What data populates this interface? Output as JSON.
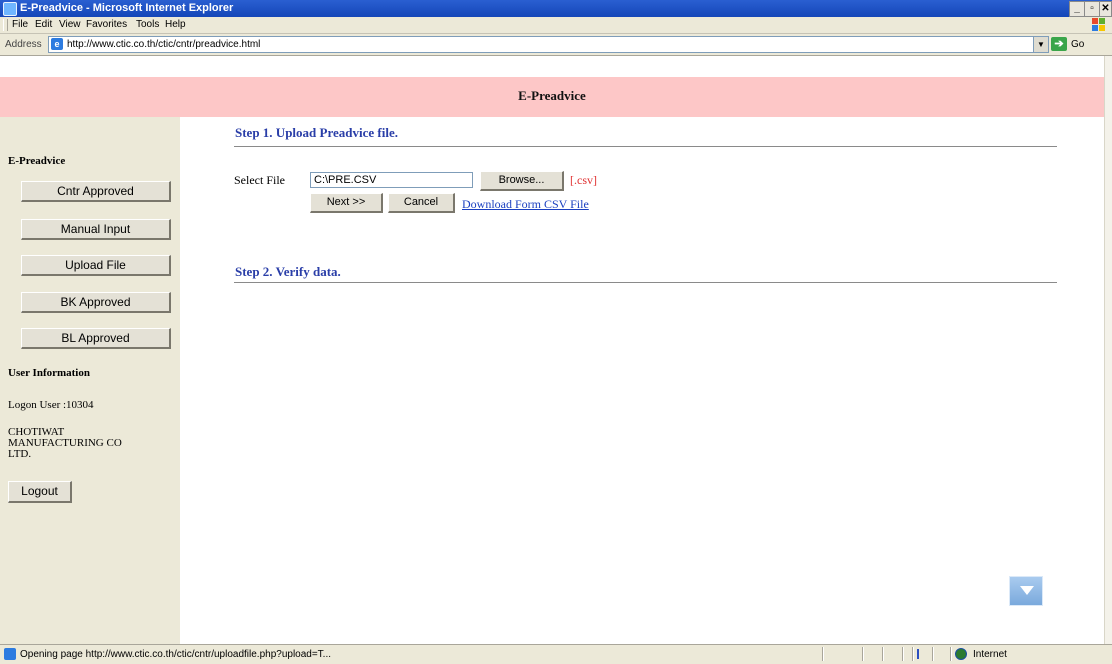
{
  "window": {
    "title": "E-Preadvice - Microsoft Internet Explorer",
    "controls": [
      "_",
      "▫",
      "✕"
    ]
  },
  "menu": [
    "File",
    "Edit",
    "View",
    "Favorites",
    "Tools",
    "Help"
  ],
  "address_bar": {
    "label": "Address",
    "url": "http://www.ctic.co.th/ctic/cntr/preadvice.html",
    "go_label": "Go"
  },
  "page": {
    "header_title": "E-Preadvice",
    "sidebar": {
      "section_title": "E-Preadvice",
      "buttons": [
        "Cntr Approved",
        "Manual  Input",
        "Upload  File",
        "BK Approved",
        "BL Approved"
      ],
      "user_info_title": "User Information",
      "logon_user": "Logon User :10304",
      "company": [
        "CHOTIWAT",
        "MANUFACTURING CO",
        "LTD."
      ],
      "logout_label": "Logout"
    },
    "step1": {
      "title": "Step 1. Upload Preadvice file.",
      "select_label": "Select File",
      "file_value": "C:\\PRE.CSV",
      "browse_label": "Browse...",
      "ext_note": "[.csv]",
      "next_label": "Next >>",
      "cancel_label": "Cancel",
      "download_link": "Download Form CSV File"
    },
    "step2": {
      "title": "Step 2. Verify data."
    }
  },
  "status_bar": {
    "text": "Opening page http://www.ctic.co.th/ctic/cntr/uploadfile.php?upload=T...",
    "zone": "Internet"
  }
}
